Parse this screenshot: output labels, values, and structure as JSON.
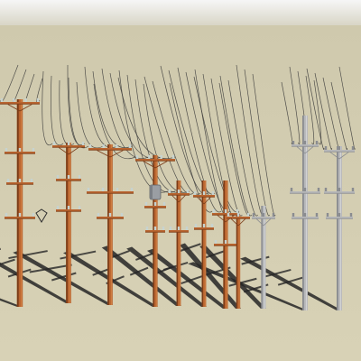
{
  "scene": {
    "sky_color": "#f6f6f6",
    "horizon_color": "#d6d3c3",
    "ground_color": "#d8d2b6",
    "ground_far_color": "#cfc9ad",
    "shadow_color": "#262626",
    "wire_color": "#3a3a3a",
    "wood_color": "#b9642f",
    "wood_dark_color": "#7a3c18",
    "wood_light_color": "#d98a4c",
    "metal_color": "#b7b8ba",
    "metal_dark_color": "#8a8c90",
    "metal_light_color": "#dcdde0",
    "insulator_color": "#c7d3cf",
    "transformer_color": "#9a9ea3"
  },
  "poles": [
    {
      "name": "wood-pole-tall-left",
      "material": "wood",
      "crossarms": 4,
      "has_transformer": false
    },
    {
      "name": "wood-pole-2",
      "material": "wood",
      "crossarms": 3,
      "has_transformer": false
    },
    {
      "name": "wood-pole-3",
      "material": "wood",
      "crossarms": 3,
      "has_transformer": false
    },
    {
      "name": "wood-pole-transformer",
      "material": "wood",
      "crossarms": 3,
      "has_transformer": true
    },
    {
      "name": "wood-pole-5",
      "material": "wood",
      "crossarms": 2,
      "has_transformer": false
    },
    {
      "name": "wood-pole-6",
      "material": "wood",
      "crossarms": 2,
      "has_transformer": false
    },
    {
      "name": "wood-pole-7",
      "material": "wood",
      "crossarms": 2,
      "has_transformer": false
    },
    {
      "name": "wood-pole-8",
      "material": "wood",
      "crossarms": 1,
      "has_transformer": false
    },
    {
      "name": "metal-pole-short",
      "material": "metal",
      "crossarms": 1,
      "has_transformer": false
    },
    {
      "name": "metal-pole-tall",
      "material": "metal",
      "crossarms": 3,
      "has_transformer": false
    },
    {
      "name": "metal-pole-right",
      "material": "metal",
      "crossarms": 3,
      "has_transformer": false
    }
  ]
}
